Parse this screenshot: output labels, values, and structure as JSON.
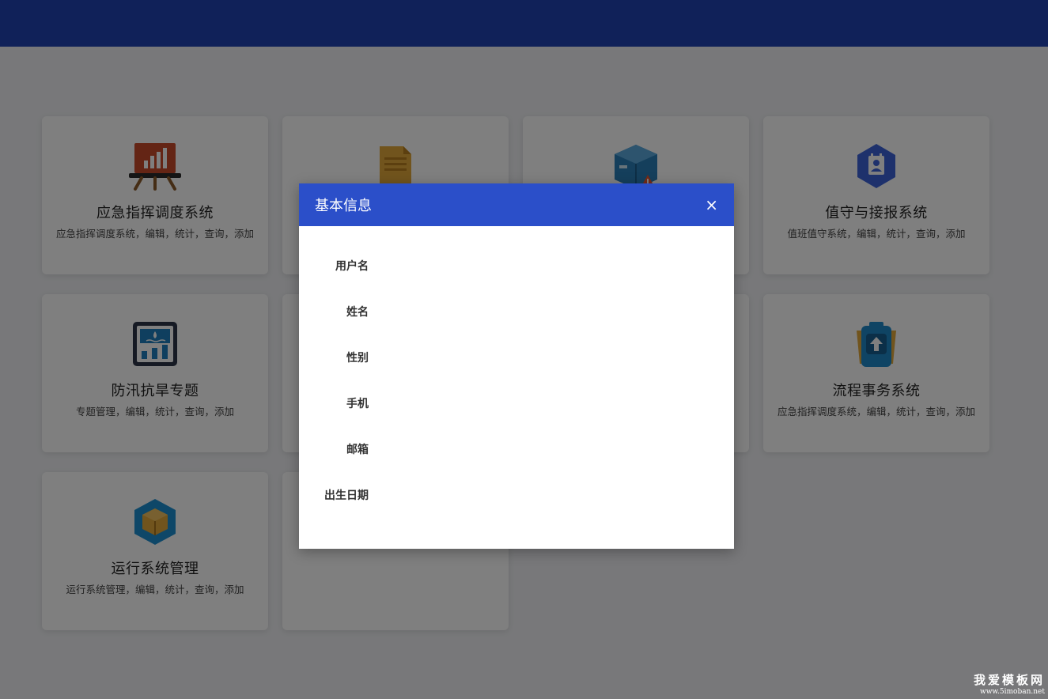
{
  "cards": [
    {
      "title": "应急指挥调度系统",
      "desc": "应急指挥调度系统，编辑，统计，查询，添加",
      "icon": "presentation-chart-icon"
    },
    {
      "title": "",
      "desc": "",
      "icon": "document-icon"
    },
    {
      "title": "",
      "desc": "",
      "icon": "box-warning-icon"
    },
    {
      "title": "值守与接报系统",
      "desc": "值班值守系统，编辑，统计，查询，添加",
      "icon": "contact-book-icon"
    },
    {
      "title": "防汛抗旱专题",
      "desc": "专题管理，编辑，统计，查询，添加",
      "icon": "monitor-chart-icon"
    },
    {
      "title": "流程事务系统",
      "desc": "应急指挥调度系统，编辑，统计，查询，添加",
      "icon": "upload-clipboard-icon"
    },
    {
      "title": "运行系统管理",
      "desc": "运行系统管理，编辑，统计，查询，添加",
      "icon": "package-hexagon-icon"
    },
    {
      "title": "",
      "desc": "",
      "icon": "add-icon"
    }
  ],
  "modal": {
    "title": "基本信息",
    "close_icon": "×",
    "fields": [
      "用户名",
      "姓名",
      "性别",
      "手机",
      "邮箱",
      "出生日期"
    ]
  },
  "watermark": {
    "line1": "我爱模板网",
    "line2": "www.5imoban.net"
  },
  "colors": {
    "topbar": "#2043b2",
    "modal_header": "#2b4fc9",
    "overlay": "rgba(0,0,0,0.5)"
  }
}
